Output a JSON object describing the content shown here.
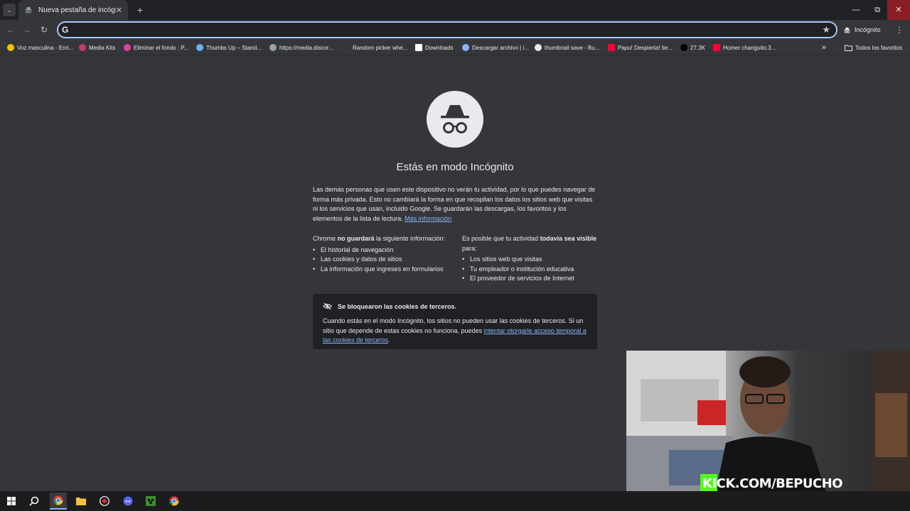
{
  "tabstrip": {
    "tab_title": "Nueva pestaña de incógnito",
    "new_tab_label": "+",
    "win_min": "—",
    "win_restore": "⧉",
    "win_close": "✕"
  },
  "toolbar": {
    "search_placeholder": "",
    "incognito_label": "Incógnito"
  },
  "bookmarks": [
    {
      "label": "Voz masculina - Enri...",
      "color": "#f2c300"
    },
    {
      "label": "Media Kits",
      "color": "#c9376e"
    },
    {
      "label": "Eliminar el fondo : P...",
      "color": "#e040a0"
    },
    {
      "label": "Thumbs Up – Stand...",
      "color": "#6ab0ff"
    },
    {
      "label": "https://media.discor...",
      "color": "#9aa0a6"
    },
    {
      "label": "Random picker whe...",
      "color": "#35363a"
    },
    {
      "label": "Downloads",
      "color": "#ffffff"
    },
    {
      "label": "Descargar archivo | i...",
      "color": "#8ab4f8"
    },
    {
      "label": "thumbnail save - Bu...",
      "color": "#e8eaed"
    },
    {
      "label": "Papu! Despierta! tie...",
      "color": "#ff0033"
    },
    {
      "label": "27.3K",
      "color": "#000000"
    },
    {
      "label": "Homer changuito.3...",
      "color": "#ff0033"
    }
  ],
  "bookmarks_more": "»",
  "bookmarks_all": "Todos los favoritos",
  "main": {
    "heading": "Estás en modo Incógnito",
    "intro": "Las demás personas que usen este dispositivo no verán tu actividad, por lo que puedes navegar de forma más privada. Esto no cambiará la forma en que recopilan los datos los sitios web que visitas ni los servicios que usan, incluido Google. Se guardarán las descargas, los favoritos y los elementos de la lista de lectura.",
    "more_info": "Más información",
    "left_col_title_a": "Chrome ",
    "left_col_title_b": "no guardará",
    "left_col_title_c": " la siguiente información:",
    "left_items": [
      "El historial de navegación",
      "Las cookies y datos de sitios",
      "La información que ingreses en formularios"
    ],
    "right_col_title_a": "Es posible que tu actividad ",
    "right_col_title_b": "todavía sea visible",
    "right_col_title_c": " para:",
    "right_items": [
      "Los sitios web que visitas",
      "Tu empleador o institución educativa",
      "El proveedor de servicios de Internet"
    ],
    "cookie_title": "Se bloquearon las cookies de terceros.",
    "cookie_body": "Cuando estás en el modo Incógnito, los sitios no pueden usar las cookies de terceros. Si un sitio que depende de estas cookies no funciona, puedes ",
    "cookie_link": "intentar otorgarle acceso temporal a las cookies de terceros",
    "cookie_end": "."
  },
  "overlay": {
    "kick_handle": "KICK.COM/BEPUCHO"
  }
}
